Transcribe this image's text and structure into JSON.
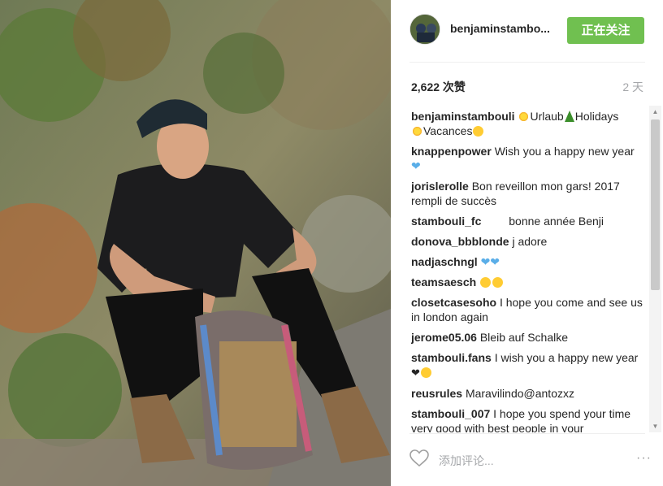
{
  "post": {
    "username": "benjaminstambo...",
    "follow_label": "正在关注",
    "likes": "2,622 次赞",
    "time": "2 天"
  },
  "comments": [
    {
      "user": "benjaminstambouli",
      "text_parts": [
        "sun",
        "Urlaub",
        "tree",
        "Holidays",
        "sun",
        "Vacances",
        "laugh"
      ]
    },
    {
      "user": "knappenpower",
      "text": "Wish you a happy new year",
      "trail": "blue-heart"
    },
    {
      "user": "jorislerolle",
      "text": "Bon reveillon mon gars! 2017 rempli de succès"
    },
    {
      "user": "stambouli_fc",
      "text": "bonne année Benji"
    },
    {
      "user": "donova_bbblonde",
      "text": "j adore"
    },
    {
      "user": "nadjaschngl",
      "text": ""
    },
    {
      "user": "teamsaesch",
      "text": ""
    },
    {
      "user": "closetcasesoho",
      "text": "I hope you come and see us in london again"
    },
    {
      "user": "jerome05.06",
      "text": "Bleib auf Schalke"
    },
    {
      "user": "stambouli.fans",
      "text": "I wish you a happy new year"
    },
    {
      "user": "reusrules",
      "text": "Maravilindo@antozxz"
    },
    {
      "user": "stambouli_007",
      "text": "I hope you spend your time very good with best people in your"
    }
  ],
  "caption": {
    "urlaub": "Urlaub",
    "holidays": "Holidays",
    "vacances": "Vacances"
  },
  "footer": {
    "placeholder": "添加评论...",
    "more": "···"
  },
  "icons": {
    "heart": "heart-outline-icon",
    "more": "more-options-icon"
  },
  "colors": {
    "follow_bg": "#70c050",
    "muted": "#a5a7aa"
  }
}
